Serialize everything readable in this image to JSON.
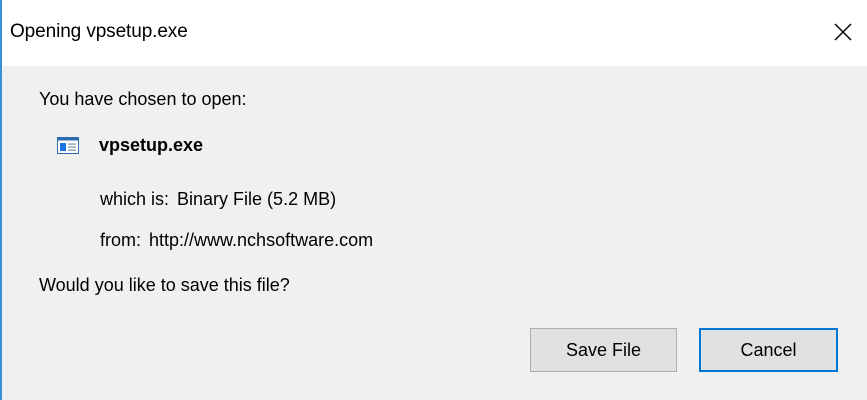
{
  "dialog": {
    "title": "Opening vpsetup.exe",
    "close_icon": "close-icon"
  },
  "body": {
    "intro": "You have chosen to open:",
    "file": {
      "icon": "executable-file-icon",
      "name": "vpsetup.exe"
    },
    "type_label": "which is:",
    "type_value": "Binary File (5.2 MB)",
    "source_label": "from:",
    "source_value": "http://www.nchsoftware.com",
    "question": "Would you like to save this file?"
  },
  "buttons": {
    "save": "Save File",
    "cancel": "Cancel"
  },
  "colors": {
    "accent": "#0078d7",
    "window_border": "#3b8fd6",
    "content_bg": "#f0f0f0",
    "button_bg": "#e1e1e1"
  }
}
